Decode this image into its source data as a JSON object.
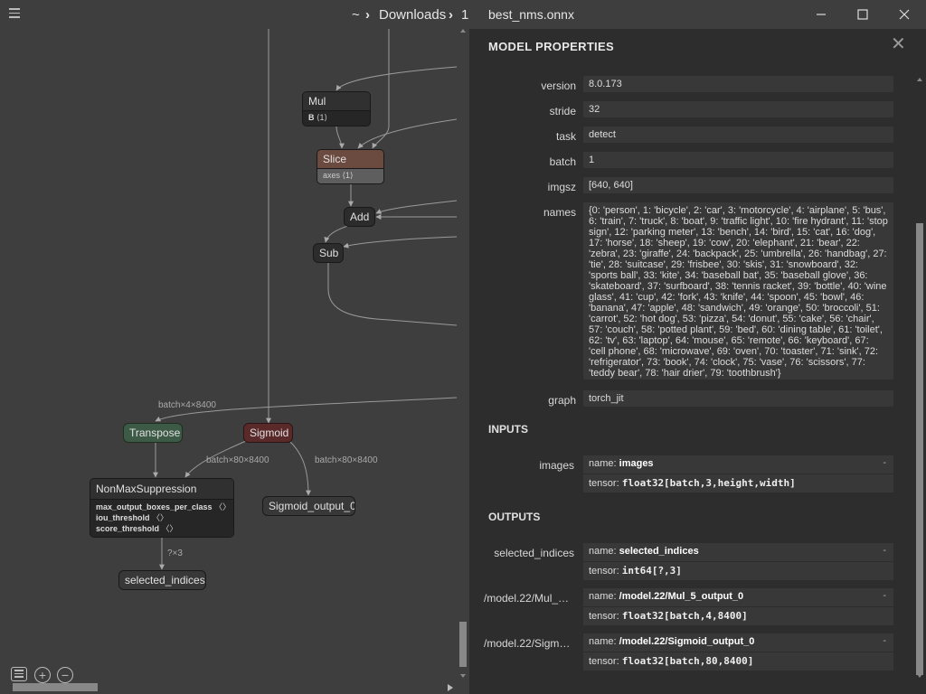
{
  "header": {
    "breadcrumb": [
      "~",
      "Downloads",
      "1"
    ],
    "file_name": "best_nms.onnx",
    "window_controls": [
      "minimize",
      "maximize",
      "close"
    ]
  },
  "graph": {
    "nodes": {
      "mul": {
        "title": "Mul",
        "attr_name": "B",
        "attr_value": "⟨1⟩"
      },
      "slice": {
        "title": "Slice",
        "attr_name": "axes",
        "attr_value": "⟨1⟩"
      },
      "add": {
        "title": "Add"
      },
      "sub": {
        "title": "Sub"
      },
      "transpose": {
        "title": "Transpose"
      },
      "sigmoid": {
        "title": "Sigmoid"
      },
      "nms": {
        "title": "NonMaxSuppression",
        "attrs": [
          {
            "name": "max_output_boxes_per_class",
            "value": "〈〉"
          },
          {
            "name": "iou_threshold",
            "value": "〈〉"
          },
          {
            "name": "score_threshold",
            "value": "〈〉"
          }
        ]
      },
      "sigmoid_output": {
        "title": "Sigmoid_output_0"
      },
      "selected_indices": {
        "title": "selected_indices"
      }
    },
    "edge_labels": {
      "transpose_in": "batch×4×8400",
      "sigmoid_to_nms": "batch×80×8400",
      "sigmoid_to_output": "batch×80×8400",
      "nms_out": "?×3"
    }
  },
  "panel": {
    "title": "MODEL PROPERTIES",
    "properties": [
      {
        "label": "version",
        "value": "8.0.173"
      },
      {
        "label": "stride",
        "value": "32"
      },
      {
        "label": "task",
        "value": "detect"
      },
      {
        "label": "batch",
        "value": "1"
      },
      {
        "label": "imgsz",
        "value": "[640, 640]"
      },
      {
        "label": "names",
        "value": "{0: 'person', 1: 'bicycle', 2: 'car', 3: 'motorcycle', 4: 'airplane', 5: 'bus', 6: 'train', 7: 'truck', 8: 'boat', 9: 'traffic light', 10: 'fire hydrant', 11: 'stop sign', 12: 'parking meter', 13: 'bench', 14: 'bird', 15: 'cat', 16: 'dog', 17: 'horse', 18: 'sheep', 19: 'cow', 20: 'elephant', 21: 'bear', 22: 'zebra', 23: 'giraffe', 24: 'backpack', 25: 'umbrella', 26: 'handbag', 27: 'tie', 28: 'suitcase', 29: 'frisbee', 30: 'skis', 31: 'snowboard', 32: 'sports ball', 33: 'kite', 34: 'baseball bat', 35: 'baseball glove', 36: 'skateboard', 37: 'surfboard', 38: 'tennis racket', 39: 'bottle', 40: 'wine glass', 41: 'cup', 42: 'fork', 43: 'knife', 44: 'spoon', 45: 'bowl', 46: 'banana', 47: 'apple', 48: 'sandwich', 49: 'orange', 50: 'broccoli', 51: 'carrot', 52: 'hot dog', 53: 'pizza', 54: 'donut', 55: 'cake', 56: 'chair', 57: 'couch', 58: 'potted plant', 59: 'bed', 60: 'dining table', 61: 'toilet', 62: 'tv', 63: 'laptop', 64: 'mouse', 65: 'remote', 66: 'keyboard', 67: 'cell phone', 68: 'microwave', 69: 'oven', 70: 'toaster', 71: 'sink', 72: 'refrigerator', 73: 'book', 74: 'clock', 75: 'vase', 76: 'scissors', 77: 'teddy bear', 78: 'hair drier', 79: 'toothbrush'}"
      },
      {
        "label": "graph",
        "value": "torch_jit"
      }
    ],
    "inputs_title": "INPUTS",
    "inputs": [
      {
        "label": "images",
        "name_prefix": "name:",
        "name": "images",
        "tensor_prefix": "tensor:",
        "tensor": "float32[batch,3,height,width]",
        "toggle": "-"
      }
    ],
    "outputs_title": "OUTPUTS",
    "outputs": [
      {
        "label": "selected_indices",
        "name_prefix": "name:",
        "name": "selected_indices",
        "tensor_prefix": "tensor:",
        "tensor": "int64[?,3]",
        "toggle": "-"
      },
      {
        "label": "/model.22/Mul_5…",
        "name_prefix": "name:",
        "name": "/model.22/Mul_5_output_0",
        "tensor_prefix": "tensor:",
        "tensor": "float32[batch,4,8400]",
        "toggle": "-"
      },
      {
        "label": "/model.22/Sigmo…",
        "name_prefix": "name:",
        "name": "/model.22/Sigmoid_output_0",
        "tensor_prefix": "tensor:",
        "tensor": "float32[batch,80,8400]",
        "toggle": "-"
      }
    ]
  },
  "colors": {
    "canvas_bg": "#3e3e3e",
    "panel_bg": "#2d2d2d",
    "node_header_slice": "#6b4a40",
    "node_header_sigmoid": "#5a2a2a",
    "node_header_transpose": "#3c5a46"
  },
  "icons": [
    "menu-icon",
    "chevron-right-icon",
    "minimize-icon",
    "maximize-icon",
    "close-icon",
    "zoom-in-icon",
    "zoom-out-icon",
    "list-icon"
  ]
}
